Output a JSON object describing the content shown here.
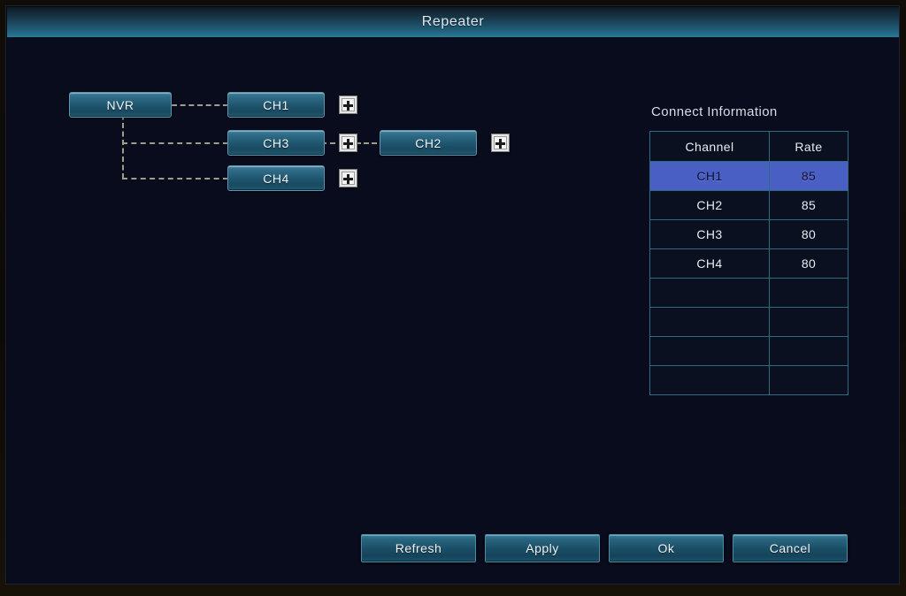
{
  "window": {
    "title": "Repeater"
  },
  "tree": {
    "root": {
      "label": "NVR"
    },
    "branches": [
      {
        "label": "CH1",
        "add_icon": "plus-icon"
      },
      {
        "label": "CH3",
        "add_icon": "plus-icon"
      },
      {
        "label": "CH4",
        "add_icon": "plus-icon"
      }
    ],
    "child": {
      "label": "CH2",
      "add_icon": "plus-icon"
    }
  },
  "connect_information": {
    "title": "Connect Information",
    "columns": [
      "Channel",
      "Rate"
    ],
    "rows": [
      {
        "channel": "CH1",
        "rate": "85",
        "selected": true
      },
      {
        "channel": "CH2",
        "rate": "85",
        "selected": false
      },
      {
        "channel": "CH3",
        "rate": "80",
        "selected": false
      },
      {
        "channel": "CH4",
        "rate": "80",
        "selected": false
      },
      {
        "channel": "",
        "rate": "",
        "selected": false
      },
      {
        "channel": "",
        "rate": "",
        "selected": false
      },
      {
        "channel": "",
        "rate": "",
        "selected": false
      },
      {
        "channel": "",
        "rate": "",
        "selected": false
      }
    ]
  },
  "footer": {
    "refresh_label": "Refresh",
    "apply_label": "Apply",
    "ok_label": "Ok",
    "cancel_label": "Cancel"
  },
  "colors": {
    "accent_teal": "#2a7d99",
    "dialog_bg": "#080c1c",
    "selection_blue": "#4a5fc4",
    "dash_line": "#9aa08a",
    "table_border": "#2f6a7e"
  }
}
